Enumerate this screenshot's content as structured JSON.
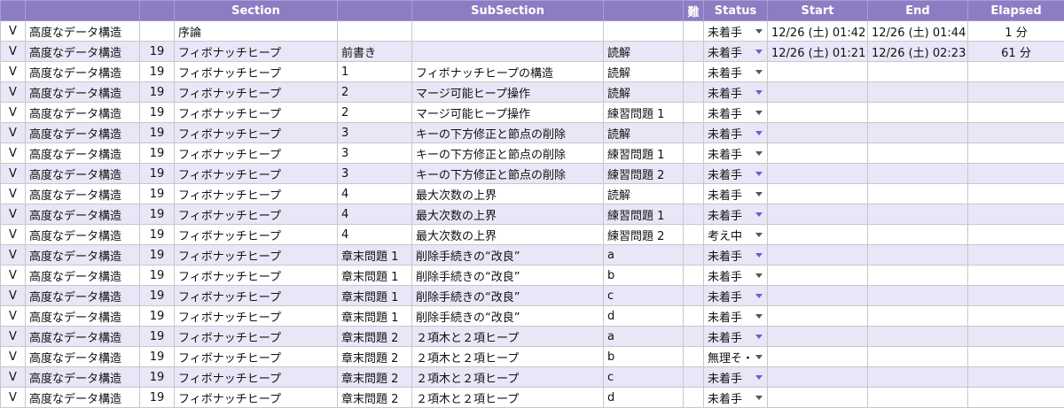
{
  "header": {
    "check": "",
    "category": "",
    "chapter": "",
    "section": "Section",
    "subsection_no": "",
    "subsection": "SubSection",
    "task": "",
    "difficulty": "難",
    "status": "Status",
    "start": "Start",
    "end": "End",
    "elapsed": "Elapsed"
  },
  "rows": [
    {
      "check": "V",
      "category": "高度なデータ構造",
      "chapter": "",
      "section": "序論",
      "subsection_no": "",
      "subsection": "",
      "task": "",
      "difficulty": "",
      "status": "未着手",
      "start": "12/26 (土) 01:42",
      "end": "12/26 (土) 01:44",
      "elapsed": "1 分"
    },
    {
      "check": "V",
      "category": "高度なデータ構造",
      "chapter": "19",
      "section": "フィボナッチヒープ",
      "subsection_no": "前書き",
      "subsection": "",
      "task": "読解",
      "difficulty": "",
      "status": "未着手",
      "start": "12/26 (土) 01:21",
      "end": "12/26 (土) 02:23",
      "elapsed": "61 分"
    },
    {
      "check": "V",
      "category": "高度なデータ構造",
      "chapter": "19",
      "section": "フィボナッチヒープ",
      "subsection_no": "1",
      "subsection": "フィボナッチヒープの構造",
      "task": "読解",
      "difficulty": "",
      "status": "未着手",
      "start": "",
      "end": "",
      "elapsed": ""
    },
    {
      "check": "V",
      "category": "高度なデータ構造",
      "chapter": "19",
      "section": "フィボナッチヒープ",
      "subsection_no": "2",
      "subsection": "マージ可能ヒープ操作",
      "task": "読解",
      "difficulty": "",
      "status": "未着手",
      "start": "",
      "end": "",
      "elapsed": ""
    },
    {
      "check": "V",
      "category": "高度なデータ構造",
      "chapter": "19",
      "section": "フィボナッチヒープ",
      "subsection_no": "2",
      "subsection": "マージ可能ヒープ操作",
      "task": "練習問題 1",
      "difficulty": "",
      "status": "未着手",
      "start": "",
      "end": "",
      "elapsed": ""
    },
    {
      "check": "V",
      "category": "高度なデータ構造",
      "chapter": "19",
      "section": "フィボナッチヒープ",
      "subsection_no": "3",
      "subsection": "キーの下方修正と節点の削除",
      "task": "読解",
      "difficulty": "",
      "status": "未着手",
      "start": "",
      "end": "",
      "elapsed": ""
    },
    {
      "check": "V",
      "category": "高度なデータ構造",
      "chapter": "19",
      "section": "フィボナッチヒープ",
      "subsection_no": "3",
      "subsection": "キーの下方修正と節点の削除",
      "task": "練習問題 1",
      "difficulty": "",
      "status": "未着手",
      "start": "",
      "end": "",
      "elapsed": ""
    },
    {
      "check": "V",
      "category": "高度なデータ構造",
      "chapter": "19",
      "section": "フィボナッチヒープ",
      "subsection_no": "3",
      "subsection": "キーの下方修正と節点の削除",
      "task": "練習問題 2",
      "difficulty": "",
      "status": "未着手",
      "start": "",
      "end": "",
      "elapsed": ""
    },
    {
      "check": "V",
      "category": "高度なデータ構造",
      "chapter": "19",
      "section": "フィボナッチヒープ",
      "subsection_no": "4",
      "subsection": "最大次数の上界",
      "task": "読解",
      "difficulty": "",
      "status": "未着手",
      "start": "",
      "end": "",
      "elapsed": ""
    },
    {
      "check": "V",
      "category": "高度なデータ構造",
      "chapter": "19",
      "section": "フィボナッチヒープ",
      "subsection_no": "4",
      "subsection": "最大次数の上界",
      "task": "練習問題 1",
      "difficulty": "",
      "status": "未着手",
      "start": "",
      "end": "",
      "elapsed": ""
    },
    {
      "check": "V",
      "category": "高度なデータ構造",
      "chapter": "19",
      "section": "フィボナッチヒープ",
      "subsection_no": "4",
      "subsection": "最大次数の上界",
      "task": "練習問題 2",
      "difficulty": "",
      "status": "考え中",
      "start": "",
      "end": "",
      "elapsed": ""
    },
    {
      "check": "V",
      "category": "高度なデータ構造",
      "chapter": "19",
      "section": "フィボナッチヒープ",
      "subsection_no": "章末問題 1",
      "subsection": "削除手続きの“改良”",
      "task": "a",
      "difficulty": "",
      "status": "未着手",
      "start": "",
      "end": "",
      "elapsed": ""
    },
    {
      "check": "V",
      "category": "高度なデータ構造",
      "chapter": "19",
      "section": "フィボナッチヒープ",
      "subsection_no": "章末問題 1",
      "subsection": "削除手続きの“改良”",
      "task": "b",
      "difficulty": "",
      "status": "未着手",
      "start": "",
      "end": "",
      "elapsed": ""
    },
    {
      "check": "V",
      "category": "高度なデータ構造",
      "chapter": "19",
      "section": "フィボナッチヒープ",
      "subsection_no": "章末問題 1",
      "subsection": "削除手続きの“改良”",
      "task": "c",
      "difficulty": "",
      "status": "未着手",
      "start": "",
      "end": "",
      "elapsed": ""
    },
    {
      "check": "V",
      "category": "高度なデータ構造",
      "chapter": "19",
      "section": "フィボナッチヒープ",
      "subsection_no": "章末問題 1",
      "subsection": "削除手続きの“改良”",
      "task": "d",
      "difficulty": "",
      "status": "未着手",
      "start": "",
      "end": "",
      "elapsed": ""
    },
    {
      "check": "V",
      "category": "高度なデータ構造",
      "chapter": "19",
      "section": "フィボナッチヒープ",
      "subsection_no": "章末問題 2",
      "subsection": "２項木と２項ヒープ",
      "task": "a",
      "difficulty": "",
      "status": "未着手",
      "start": "",
      "end": "",
      "elapsed": ""
    },
    {
      "check": "V",
      "category": "高度なデータ構造",
      "chapter": "19",
      "section": "フィボナッチヒープ",
      "subsection_no": "章末問題 2",
      "subsection": "２項木と２項ヒープ",
      "task": "b",
      "difficulty": "",
      "status": "無理そ・",
      "start": "",
      "end": "",
      "elapsed": ""
    },
    {
      "check": "V",
      "category": "高度なデータ構造",
      "chapter": "19",
      "section": "フィボナッチヒープ",
      "subsection_no": "章末問題 2",
      "subsection": "２項木と２項ヒープ",
      "task": "c",
      "difficulty": "",
      "status": "未着手",
      "start": "",
      "end": "",
      "elapsed": ""
    },
    {
      "check": "V",
      "category": "高度なデータ構造",
      "chapter": "19",
      "section": "フィボナッチヒープ",
      "subsection_no": "章末問題 2",
      "subsection": "２項木と２項ヒープ",
      "task": "d",
      "difficulty": "",
      "status": "未着手",
      "start": "",
      "end": "",
      "elapsed": ""
    }
  ],
  "colors": {
    "header_bg": "#8e7cc3",
    "stripe_bg": "#e8e6f7",
    "dropdown_accent": "#6a5fd0"
  }
}
